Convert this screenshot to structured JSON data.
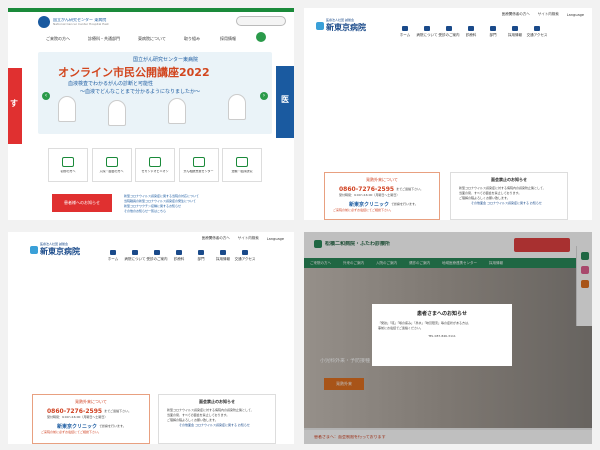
{
  "panel1": {
    "logo_text": "国立がん研究センター 東病院",
    "logo_en": "National Cancer Center Hospital East",
    "nav": [
      "ご来院の方へ",
      "診療科・共通部門",
      "東病院について",
      "取り組み",
      "採用情報"
    ],
    "hero_top": "国立がん研究センター東病院",
    "hero_title": "オンライン市民公開講座2022",
    "hero_sub": "血液検査でわかるがんの診断と可能性",
    "hero_sub2": "～血液でどんなことまで分かるようになりましたか～",
    "side_left": "す",
    "side_right": "医",
    "icons": [
      "初診の方へ",
      "入院・面会の方へ",
      "セカンドオピニオン",
      "がん相談支援センター",
      "治験・臨床研究"
    ],
    "red_button": "患者様へのお知らせ",
    "news": [
      "新型コロナウイルス感染症に関する当院の対応について",
      "当院職員の新型コロナウイルス感染症の発生について",
      "新型コロナワクチン接種に関するお知らせ",
      "その他のお知らせ一覧はこちら"
    ]
  },
  "hospital": {
    "small_name": "医療法人社団 誠馨会",
    "name": "新東京病院",
    "utility": [
      "医療関係者の方へ",
      "サイト内検索",
      "Language"
    ],
    "nav": [
      "ホーム",
      "病院について",
      "受診のご案内",
      "診療科",
      "部門",
      "採用情報",
      "交通アクセス"
    ],
    "notice_title": "発熱外来について",
    "phone": "0860-7276-2595",
    "phone_suffix": "までご連絡下さい。",
    "hours": "受付時間：9:00～16:00（月曜日～土曜日）",
    "clinic": "新東京クリニック",
    "clinic_suffix": "で診察を行います。",
    "notice_red": "ご来院の前に必ずお電話にてご相談下さい。",
    "visit_title": "面会禁止のお知らせ",
    "visit_lines": [
      "新型コロナウイルス感染症に対する病院内の感染防止策として、",
      "当面の間、すべての面会を禁止しております。",
      "ご理解の程よろしくお願い致します。"
    ],
    "visit_link": "その他面会 コロナウイルス感染症に関する お知らせ"
  },
  "panel4": {
    "hospital_name": "松橋二和病院・ふたわ診療所",
    "nav": [
      "ご来院の方へ",
      "外来のご案内",
      "入院のご案内",
      "健診のご案内",
      "地域医療連携センター",
      "採用情報"
    ],
    "photo_text": "小児科外来・予防接種",
    "modal_title": "患者さまへのお知らせ",
    "modal_lines": [
      "「発熱」「咳」「喉の痛み」「鼻水」「味覚障害」等の症状がある方は、",
      "事前にお電話でご連絡ください。"
    ],
    "modal_footer": "TEL  087-846-3111",
    "bottom_label": "患者さまへ：面会制限を行っております",
    "badge": "発熱外来"
  }
}
